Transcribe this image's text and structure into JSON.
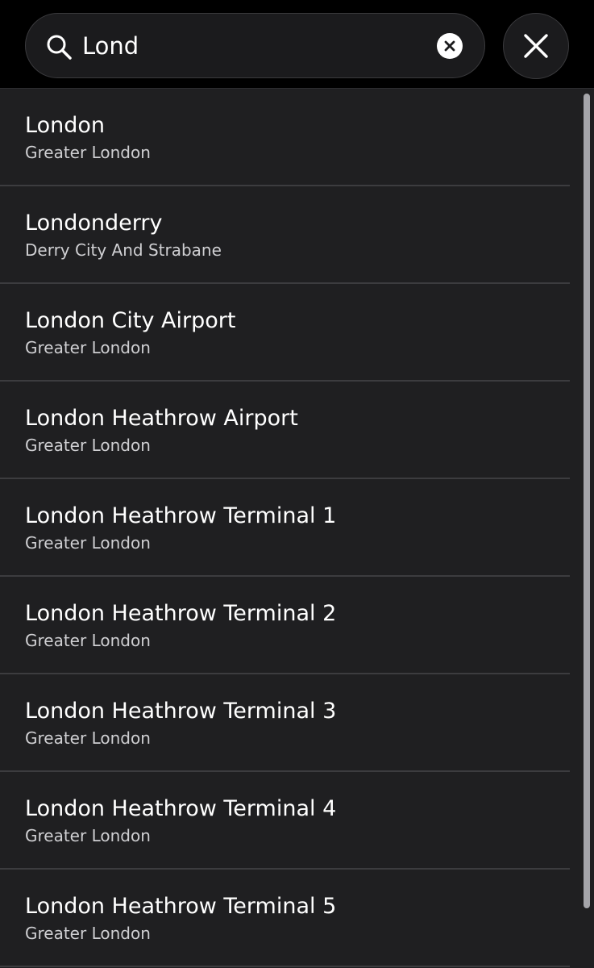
{
  "search": {
    "value": "Lond",
    "placeholder": ""
  },
  "icons": {
    "search": "search-icon",
    "clear": "clear-circle-icon",
    "close": "close-icon"
  },
  "results": [
    {
      "title": "London",
      "subtitle": "Greater London"
    },
    {
      "title": "Londonderry",
      "subtitle": "Derry City And Strabane"
    },
    {
      "title": "London City Airport",
      "subtitle": "Greater London"
    },
    {
      "title": "London Heathrow Airport",
      "subtitle": "Greater London"
    },
    {
      "title": "London Heathrow Terminal 1",
      "subtitle": "Greater London"
    },
    {
      "title": "London Heathrow Terminal 2",
      "subtitle": "Greater London"
    },
    {
      "title": "London Heathrow Terminal 3",
      "subtitle": "Greater London"
    },
    {
      "title": "London Heathrow Terminal 4",
      "subtitle": "Greater London"
    },
    {
      "title": "London Heathrow Terminal 5",
      "subtitle": "Greater London"
    }
  ],
  "colors": {
    "header_bg": "#000000",
    "list_bg": "#1f1f21",
    "divider": "#3c3c3f",
    "primary_text": "#ffffff",
    "secondary_text": "#cfcfd2",
    "scrollbar": "#a5a5aa"
  }
}
